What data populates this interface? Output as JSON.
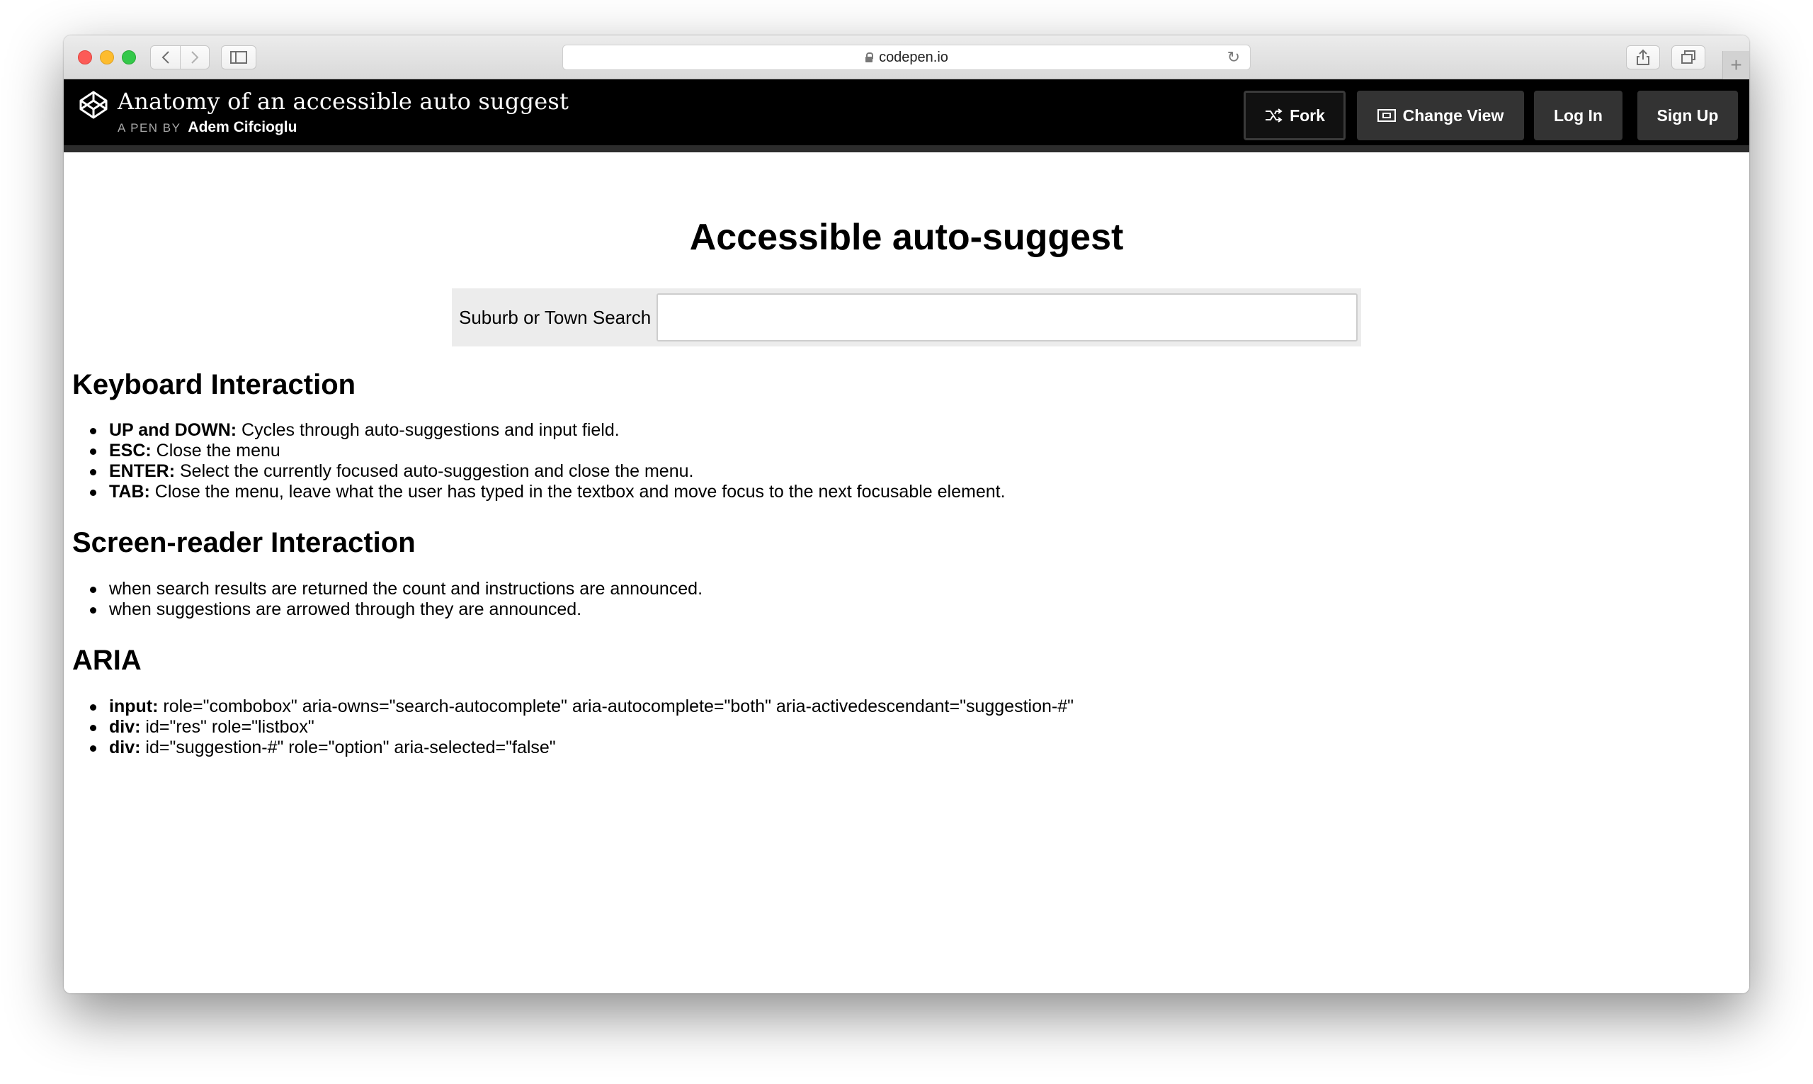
{
  "browser": {
    "url": "codepen.io"
  },
  "header": {
    "title": "Anatomy of an accessible auto suggest",
    "byline_prefix": "A PEN BY",
    "author": "Adem Cifcioglu",
    "buttons": {
      "fork": "Fork",
      "change_view": "Change View",
      "log_in": "Log In",
      "sign_up": "Sign Up"
    }
  },
  "page": {
    "title": "Accessible auto-suggest",
    "search": {
      "label": "Suburb or Town Search",
      "value": ""
    },
    "sections": [
      {
        "heading": "Keyboard Interaction",
        "items": [
          {
            "key": "UP and DOWN:",
            "text": " Cycles through auto-suggestions and input field."
          },
          {
            "key": "ESC:",
            "text": " Close the menu"
          },
          {
            "key": "ENTER:",
            "text": " Select the currently focused auto-suggestion and close the menu."
          },
          {
            "key": "TAB:",
            "text": " Close the menu, leave what the user has typed in the textbox and move focus to the next focusable element."
          }
        ]
      },
      {
        "heading": "Screen-reader Interaction",
        "items": [
          {
            "key": "",
            "text": "when search results are returned the count and instructions are announced."
          },
          {
            "key": "",
            "text": "when suggestions are arrowed through they are announced."
          }
        ]
      },
      {
        "heading": "ARIA",
        "items": [
          {
            "key": "input:",
            "text": " role=\"combobox\" aria-owns=\"search-autocomplete\" aria-autocomplete=\"both\" aria-activedescendant=\"suggestion-#\""
          },
          {
            "key": "div:",
            "text": " id=\"res\" role=\"listbox\""
          },
          {
            "key": "div:",
            "text": " id=\"suggestion-#\" role=\"option\" aria-selected=\"false\""
          }
        ]
      }
    ]
  }
}
